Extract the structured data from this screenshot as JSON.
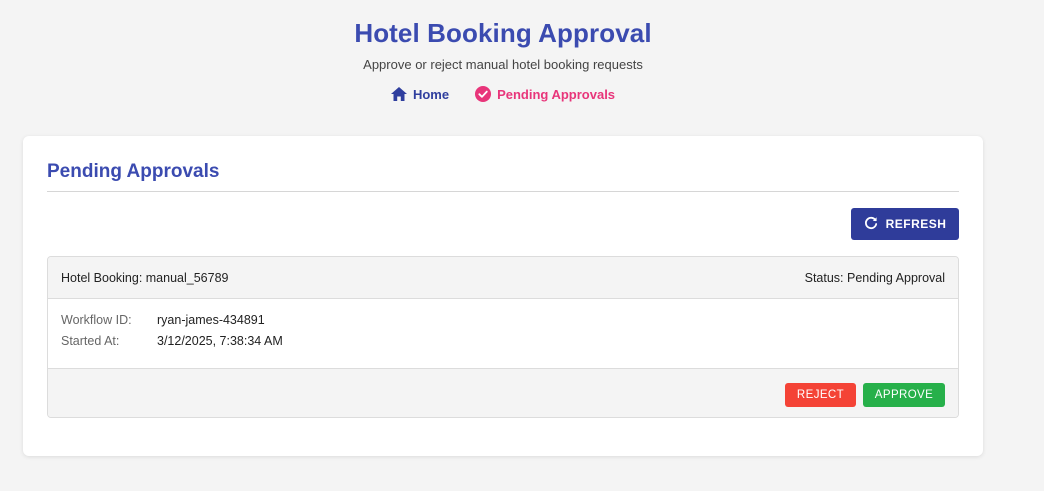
{
  "header": {
    "title": "Hotel Booking Approval",
    "subtitle": "Approve or reject manual hotel booking requests"
  },
  "nav": {
    "home_label": "Home",
    "pending_label": "Pending Approvals",
    "home_icon": "home-icon",
    "pending_icon": "check-circle-icon",
    "home_color": "#2f3e9e",
    "pending_color": "#e8357a"
  },
  "section": {
    "title": "Pending Approvals",
    "refresh_label": "REFRESH",
    "refresh_icon": "refresh-icon"
  },
  "booking": {
    "title": "Hotel Booking: manual_56789",
    "status": "Status: Pending Approval",
    "fields": [
      {
        "label": "Workflow ID:",
        "value": "ryan-james-434891"
      },
      {
        "label": "Started At:",
        "value": "3/12/2025, 7:38:34 AM"
      }
    ],
    "reject_label": "REJECT",
    "approve_label": "APPROVE"
  },
  "colors": {
    "accent": "#3b4bb0",
    "refresh_button": "#2f3c9a",
    "reject": "#f44336",
    "approve": "#27b04a"
  }
}
